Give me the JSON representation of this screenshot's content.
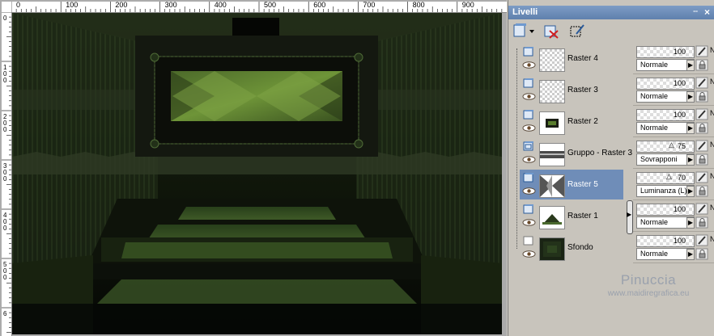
{
  "ruler_top": [
    "0",
    "100",
    "200",
    "300",
    "400",
    "500",
    "600",
    "700",
    "800",
    "900"
  ],
  "ruler_left": [
    "0",
    "1\n0\n0",
    "2\n0\n0",
    "3\n0\n0",
    "4\n0\n0",
    "5\n0\n0",
    "6"
  ],
  "panel": {
    "title": "Livelli",
    "pin": "ⵧ",
    "close": "×"
  },
  "layers": [
    {
      "name": "Raster 4",
      "opacity": "100",
      "blend": "Normale",
      "selected": false,
      "thumb": "blank",
      "vis": "raster"
    },
    {
      "name": "Raster 3",
      "opacity": "100",
      "blend": "Normale",
      "selected": false,
      "thumb": "blank",
      "vis": "raster"
    },
    {
      "name": "Raster 2",
      "opacity": "100",
      "blend": "Normale",
      "selected": false,
      "thumb": "frame",
      "vis": "raster"
    },
    {
      "name": "Gruppo - Raster 3",
      "opacity": "75",
      "blend": "Sovrapponi",
      "selected": false,
      "thumb": "strip",
      "vis": "group"
    },
    {
      "name": "Raster 5",
      "opacity": "70",
      "blend": "Luminanza (L)",
      "selected": true,
      "thumb": "diamond",
      "vis": "raster"
    },
    {
      "name": "Raster 1",
      "opacity": "100",
      "blend": "Normale",
      "selected": false,
      "thumb": "pyramid",
      "vis": "raster"
    },
    {
      "name": "Sfondo",
      "opacity": "100",
      "blend": "Normale",
      "selected": false,
      "thumb": "dark",
      "vis": "background"
    }
  ],
  "watermark": {
    "name": "Pinuccia",
    "site": "www.maidiregrafica.eu"
  },
  "colors": {
    "panel_title": "#6a8ab6",
    "selected_row": "#6f8db8",
    "canvas_green": "#3f5a22"
  }
}
